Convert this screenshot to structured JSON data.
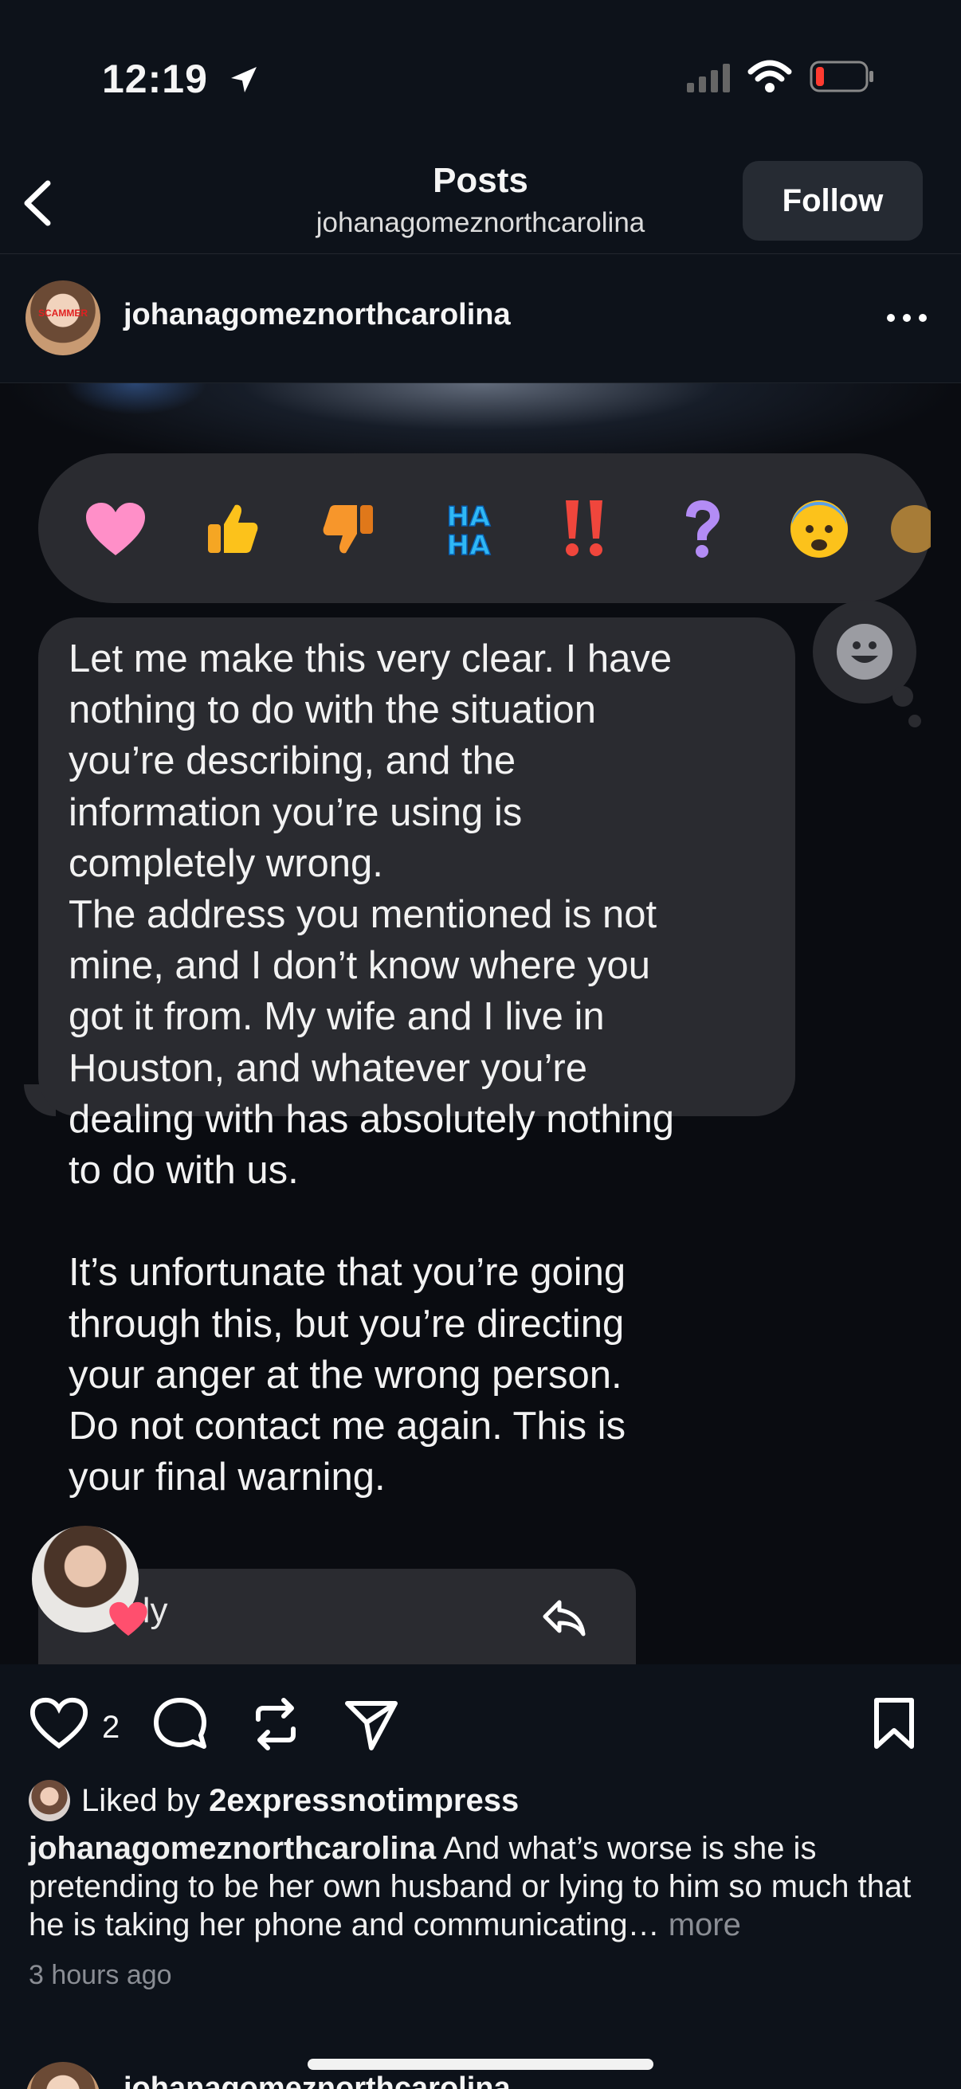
{
  "status_bar": {
    "time": "12:19"
  },
  "header": {
    "title": "Posts",
    "subtitle": "johanagomeznorthcarolina",
    "follow_label": "Follow"
  },
  "post": {
    "username": "johanagomeznorthcarolina",
    "avatar_tag": "SCAMMER",
    "image": {
      "reactions": [
        "pink-heart",
        "thumbs-up",
        "thumbs-down",
        "haha",
        "double-exclamation",
        "question-mark",
        "anxious-face",
        "partial-emoji"
      ],
      "reaction_glyphs": [
        "🩷",
        "👍",
        "👎",
        "HA\nHA",
        "‼️",
        "❓",
        "😨",
        "🎉"
      ],
      "message": "Let me make this very clear. I have\nnothing to do with the situation\nyou’re describing, and the\ninformation you’re using is\ncompletely wrong.\nThe address you mentioned is not\nmine, and I don’t know where you\ngot it from. My wife and I live in\nHouston, and whatever you’re\ndealing with has absolutely nothing\nto do with us.\n\nIt’s unfortunate that you’re going\nthrough this, but you’re directing\nyour anger at the wrong person.\nDo not contact me again. This is\nyour final warning.",
      "reply_label": "Reply"
    },
    "like_count": "2",
    "liked_by_prefix": "Liked by ",
    "liked_by_user": "2expressnotimpress",
    "caption_user": "johanagomeznorthcarolina",
    "caption_text": " And what’s worse is she is pretending to be her own husband or lying to him so much that he is taking her phone and communicating…",
    "caption_more": " more",
    "timestamp": "3 hours ago"
  },
  "next_post": {
    "username": "johanagomeznorthcarolina"
  }
}
